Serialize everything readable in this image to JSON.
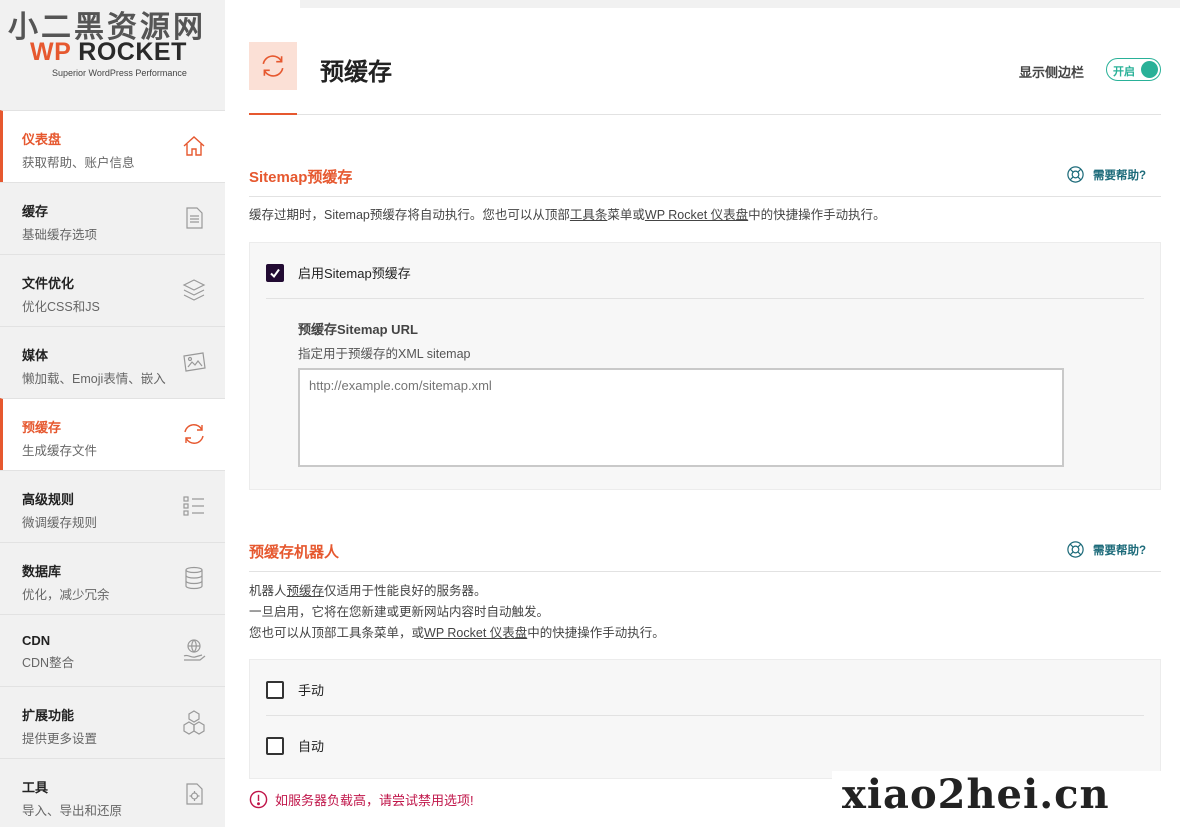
{
  "watermark": {
    "cn_text": "小二黑资源网",
    "en_text": "xiao2hei.cn"
  },
  "brand": {
    "logo_prefix": "WP",
    "logo_main": "ROCKET",
    "tagline": "Superior WordPress Performance",
    "accent_color": "#e6582f"
  },
  "sidebar": {
    "items": [
      {
        "title": "仪表盘",
        "subtitle": "获取帮助、账户信息",
        "icon": "home-icon",
        "active": true
      },
      {
        "title": "缓存",
        "subtitle": "基础缓存选项",
        "icon": "document-icon",
        "active": false
      },
      {
        "title": "文件优化",
        "subtitle": "优化CSS和JS",
        "icon": "layers-icon",
        "active": false
      },
      {
        "title": "媒体",
        "subtitle": "懒加载、Emoji表情、嵌入",
        "icon": "image-icon",
        "active": false
      },
      {
        "title": "预缓存",
        "subtitle": "生成缓存文件",
        "icon": "refresh-icon",
        "active": true
      },
      {
        "title": "高级规则",
        "subtitle": "微调缓存规则",
        "icon": "checklist-icon",
        "active": false
      },
      {
        "title": "数据库",
        "subtitle": "优化，减少冗余",
        "icon": "database-icon",
        "active": false
      },
      {
        "title": "CDN",
        "subtitle": "CDN整合",
        "icon": "globe-hand-icon",
        "active": false
      },
      {
        "title": "扩展功能",
        "subtitle": "提供更多设置",
        "icon": "cubes-icon",
        "active": false
      },
      {
        "title": "工具",
        "subtitle": "导入、导出和还原",
        "icon": "file-gear-icon",
        "active": false
      }
    ]
  },
  "header": {
    "title": "预缓存",
    "icon": "refresh-icon",
    "sidebar_toggle_label": "显示侧边栏",
    "toggle_state_label": "开启",
    "toggle_on": true,
    "toggle_color": "#29b198"
  },
  "sitemap_section": {
    "title": "Sitemap预缓存",
    "help_label": "需要帮助?",
    "description_prefix": "缓存过期时，Sitemap预缓存将自动执行。您也可以从顶部",
    "description_link1": "工具条",
    "description_mid": "菜单或",
    "description_link2": "WP Rocket 仪表盘",
    "description_suffix": "中的快捷操作手动执行。",
    "enable_label": "启用Sitemap预缓存",
    "enable_checked": true,
    "url_label": "预缓存Sitemap URL",
    "url_hint": "指定用于预缓存的XML sitemap",
    "url_placeholder": "http://example.com/sitemap.xml"
  },
  "bot_section": {
    "title": "预缓存机器人",
    "help_label": "需要帮助?",
    "line1_prefix": "机器人",
    "line1_link": "预缓存",
    "line1_suffix": "仅适用于性能良好的服务器。",
    "line2": "一旦启用，它将在您新建或更新网站内容时自动触发。",
    "line3_prefix": "您也可以从顶部工具条菜单，或",
    "line3_link": "WP Rocket 仪表盘",
    "line3_suffix": "中的快捷操作手动执行。",
    "options": [
      {
        "label": "手动",
        "checked": false
      },
      {
        "label": "自动",
        "checked": false
      }
    ],
    "warning": "如服务器负载高，请尝试禁用选项!",
    "warning_color": "#c0164a"
  }
}
